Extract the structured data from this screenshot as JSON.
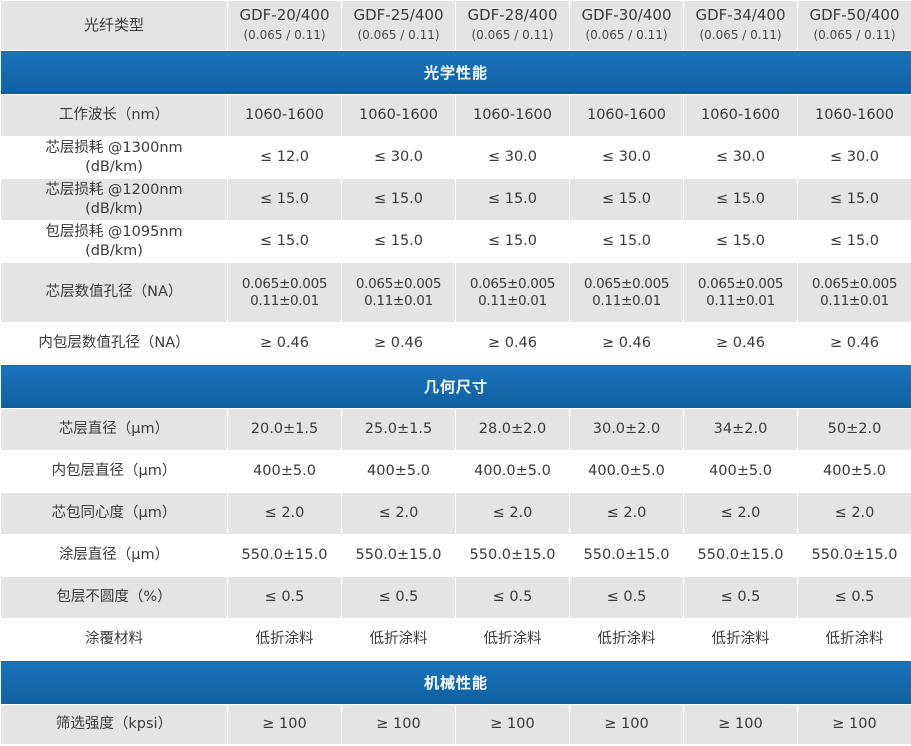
{
  "header": {
    "type_label": "光纤类型",
    "columns": [
      {
        "name": "GDF-20/400",
        "sub": "(0.065 / 0.11)"
      },
      {
        "name": "GDF-25/400",
        "sub": "(0.065 / 0.11)"
      },
      {
        "name": "GDF-28/400",
        "sub": "(0.065 / 0.11)"
      },
      {
        "name": "GDF-30/400",
        "sub": "(0.065 / 0.11)"
      },
      {
        "name": "GDF-34/400",
        "sub": "(0.065 / 0.11)"
      },
      {
        "name": "GDF-50/400",
        "sub": "(0.065 / 0.11)"
      }
    ]
  },
  "sections": [
    {
      "title": "光学性能",
      "rows": [
        {
          "label": "工作波长（nm）",
          "values": [
            "1060-1600",
            "1060-1600",
            "1060-1600",
            "1060-1600",
            "1060-1600",
            "1060-1600"
          ]
        },
        {
          "label": "芯层损耗 @1300nm",
          "label2": "(dB/km)",
          "values": [
            "≤ 12.0",
            "≤ 30.0",
            "≤ 30.0",
            "≤ 30.0",
            "≤ 30.0",
            "≤ 30.0"
          ]
        },
        {
          "label": "芯层损耗 @1200nm",
          "label2": "(dB/km)",
          "values": [
            "≤ 15.0",
            "≤ 15.0",
            "≤ 15.0",
            "≤ 15.0",
            "≤ 15.0",
            "≤ 15.0"
          ]
        },
        {
          "label": "包层损耗 @1095nm",
          "label2": "(dB/km)",
          "values": [
            "≤ 15.0",
            "≤ 15.0",
            "≤ 15.0",
            "≤ 15.0",
            "≤ 15.0",
            "≤ 15.0"
          ]
        },
        {
          "label": "芯层数值孔径（NA）",
          "values": [
            "0.065±0.005",
            "0.065±0.005",
            "0.065±0.005",
            "0.065±0.005",
            "0.065±0.005",
            "0.065±0.005"
          ],
          "values2": [
            "0.11±0.01",
            "0.11±0.01",
            "0.11±0.01",
            "0.11±0.01",
            "0.11±0.01",
            "0.11±0.01"
          ]
        },
        {
          "label": "内包层数值孔径（NA）",
          "values": [
            "≥ 0.46",
            "≥ 0.46",
            "≥ 0.46",
            "≥ 0.46",
            "≥ 0.46",
            "≥ 0.46"
          ]
        }
      ]
    },
    {
      "title": "几何尺寸",
      "rows": [
        {
          "label": "芯层直径（μm）",
          "values": [
            "20.0±1.5",
            "25.0±1.5",
            "28.0±2.0",
            "30.0±2.0",
            "34±2.0",
            "50±2.0"
          ]
        },
        {
          "label": "内包层直径（μm）",
          "values": [
            "400±5.0",
            "400±5.0",
            "400.0±5.0",
            "400.0±5.0",
            "400±5.0",
            "400±5.0"
          ]
        },
        {
          "label": "芯包同心度（μm）",
          "values": [
            "≤ 2.0",
            "≤ 2.0",
            "≤ 2.0",
            "≤ 2.0",
            "≤ 2.0",
            "≤ 2.0"
          ]
        },
        {
          "label": "涂层直径（μm）",
          "values": [
            "550.0±15.0",
            "550.0±15.0",
            "550.0±15.0",
            "550.0±15.0",
            "550.0±15.0",
            "550.0±15.0"
          ]
        },
        {
          "label": "包层不圆度（%）",
          "values": [
            "≤ 0.5",
            "≤ 0.5",
            "≤ 0.5",
            "≤ 0.5",
            "≤ 0.5",
            "≤ 0.5"
          ]
        },
        {
          "label": "涂覆材料",
          "values": [
            "低折涂料",
            "低折涂料",
            "低折涂料",
            "低折涂料",
            "低折涂料",
            "低折涂料"
          ]
        }
      ]
    },
    {
      "title": "机械性能",
      "rows": [
        {
          "label": "筛选强度（kpsi）",
          "values": [
            "≥ 100",
            "≥ 100",
            "≥ 100",
            "≥ 100",
            "≥ 100",
            "≥ 100"
          ]
        }
      ]
    }
  ]
}
